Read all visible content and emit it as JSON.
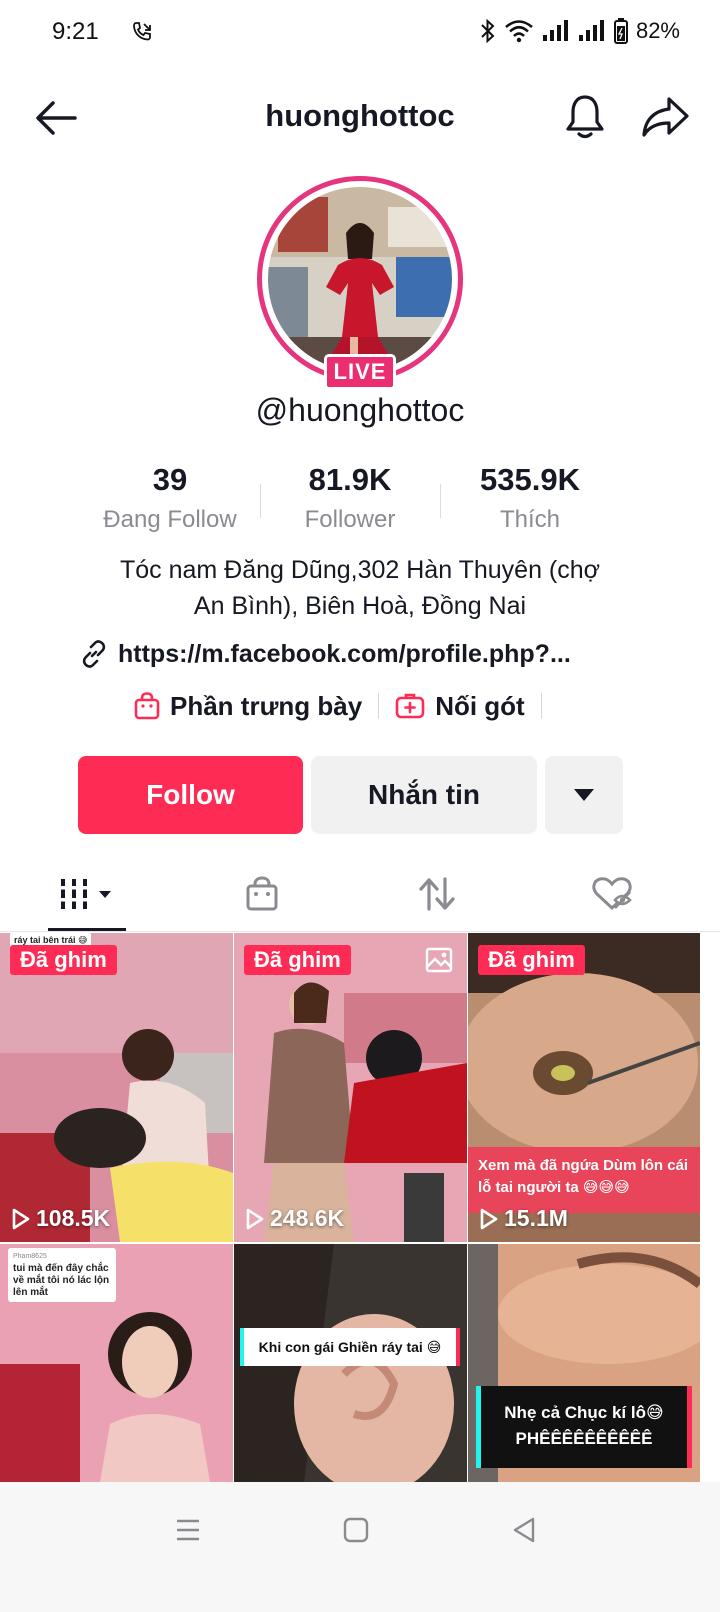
{
  "status_bar": {
    "time": "9:21",
    "battery": "82%"
  },
  "header": {
    "title": "huonghottoc"
  },
  "profile": {
    "live_label": "LIVE",
    "username": "@huonghottoc",
    "stats": [
      {
        "value": "39",
        "label": "Đang Follow"
      },
      {
        "value": "81.9K",
        "label": "Follower"
      },
      {
        "value": "535.9K",
        "label": "Thích"
      }
    ],
    "bio_line1": "Tóc nam Đăng Dũng,302 Hàn Thuyên (chợ",
    "bio_line2": "An Bình), Biên Hoà, Đồng Nai",
    "link": "https://m.facebook.com/profile.php?...",
    "showcase_label": "Phần trưng bày",
    "connect_label": "Nối gót"
  },
  "actions": {
    "follow_label": "Follow",
    "message_label": "Nhắn tin"
  },
  "tabs": [
    "videos",
    "shop",
    "reposts",
    "liked"
  ],
  "videos": [
    {
      "pinned": "Đã ghim",
      "views": "108.5K",
      "caption": "ráy tai bên trái 😅"
    },
    {
      "pinned": "Đã ghim",
      "views": "248.6K"
    },
    {
      "pinned": "Đã ghim",
      "views": "15.1M",
      "caption": "Xem mà đã ngứa Dùm lôn cái lỗ tai người ta 😅😅😅"
    },
    {
      "caption_user": "Pham8625",
      "caption": "tui mà đến đây chắc về mắt tôi nó lác lộn lên mắt"
    },
    {
      "caption": "Khi con gái Ghiền ráy tai 😅"
    },
    {
      "caption_line1": "Nhẹ cả Chục kí lô😅",
      "caption_line2": "PHÊÊÊÊÊÊÊÊÊÊ"
    }
  ],
  "colors": {
    "accent": "#fe2c55",
    "live": "#ea2e6f",
    "text": "#161823",
    "muted": "#8a8b91"
  }
}
